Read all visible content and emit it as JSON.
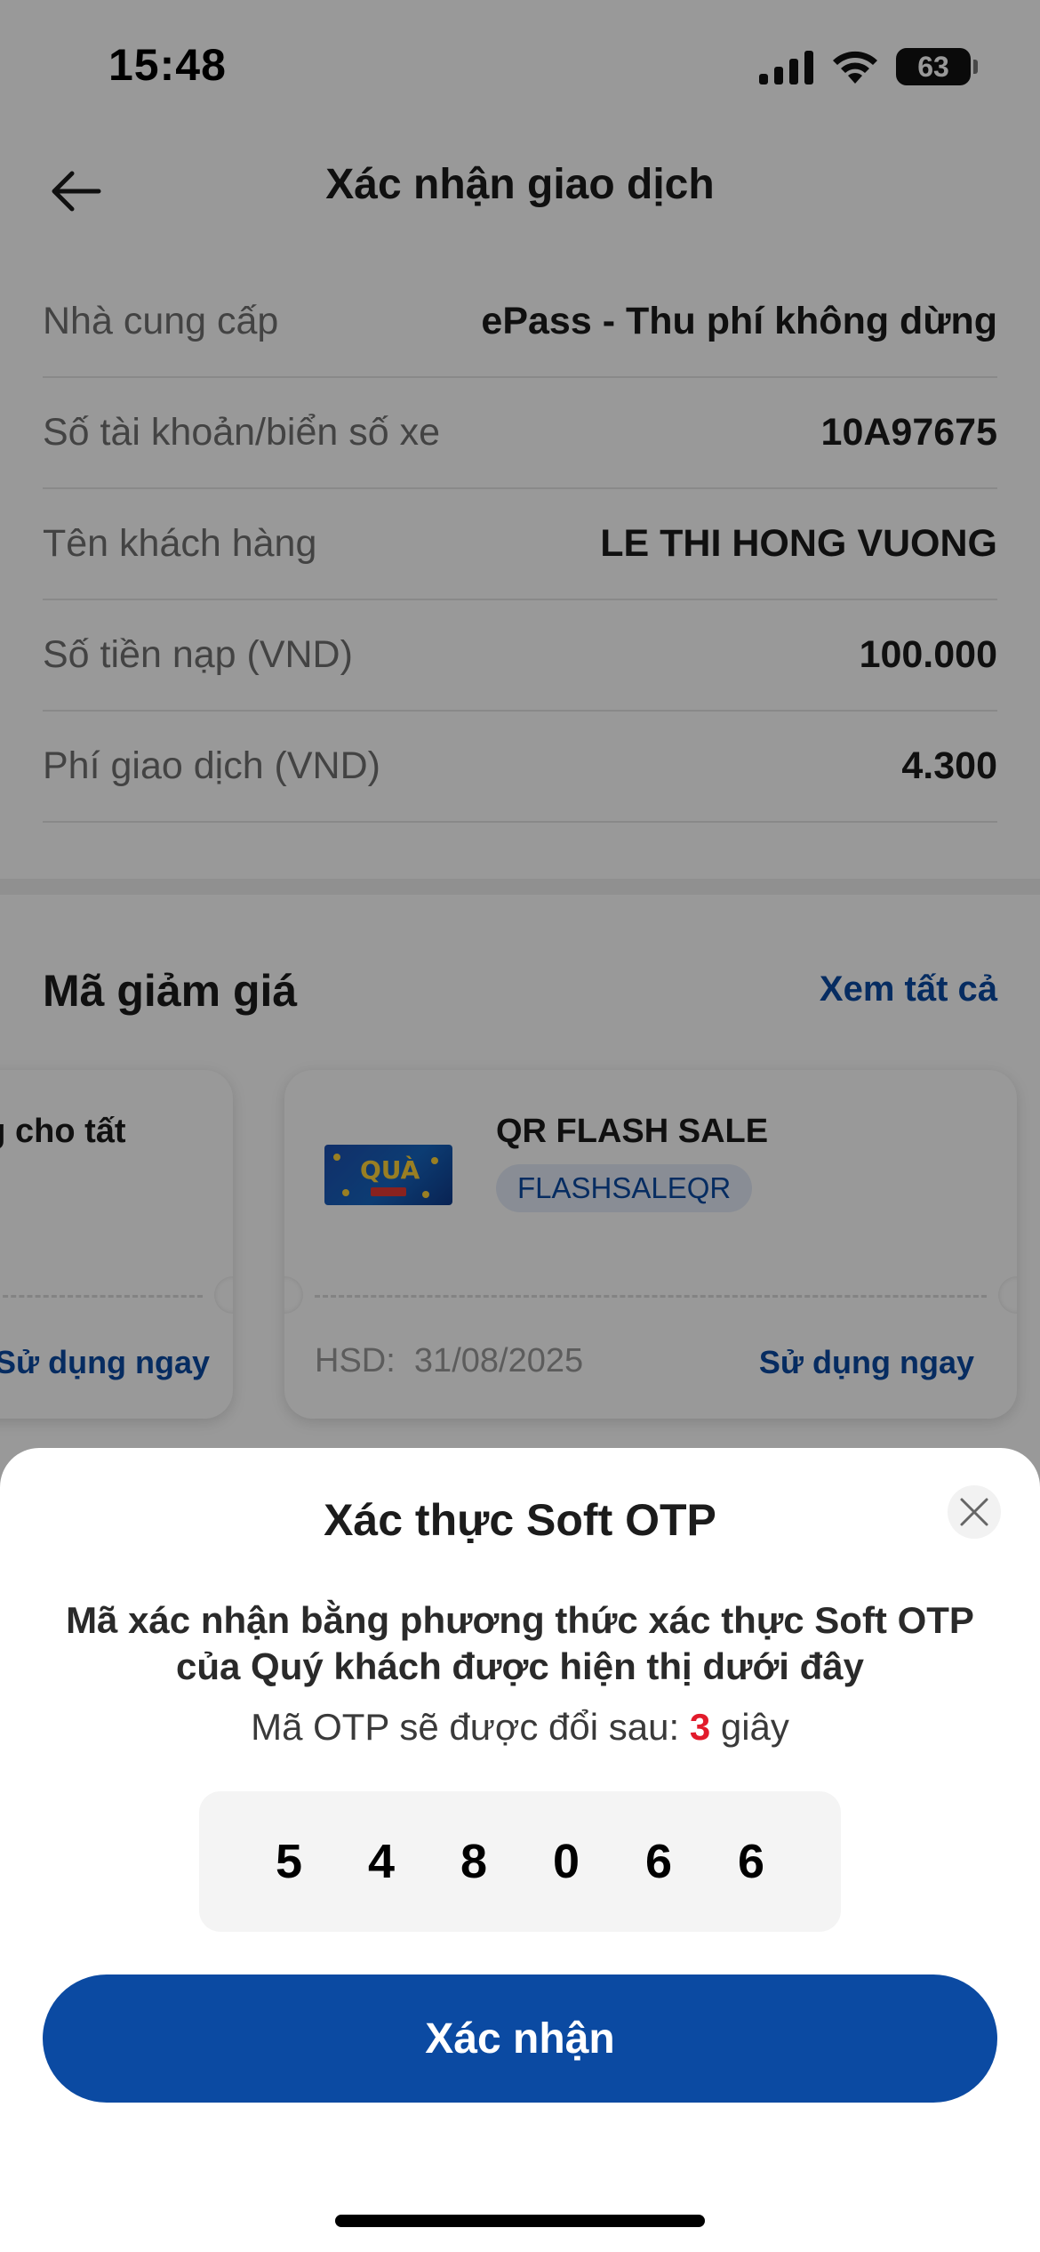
{
  "status_bar": {
    "time": "15:48",
    "battery": "63"
  },
  "header": {
    "title": "Xác nhận giao dịch"
  },
  "info_rows": [
    {
      "label": "Nhà cung cấp",
      "value": "ePass - Thu phí không dừng"
    },
    {
      "label": "Số tài khoản/biển số xe",
      "value": "10A97675"
    },
    {
      "label": "Tên khách hàng",
      "value": "LE THI HONG VUONG"
    },
    {
      "label": "Số tiền nạp (VND)",
      "value": "100.000"
    },
    {
      "label": "Phí giao dịch (VND)",
      "value": "4.300"
    }
  ],
  "discounts": {
    "title": "Mã giảm giá",
    "view_all": "Xem tất cả",
    "coupons": [
      {
        "title": "ng cho tất",
        "use_label": "Sử dụng ngay"
      },
      {
        "title": "QR FLASH SALE",
        "code": "FLASHSALEQR",
        "hsd_label": "HSD:",
        "hsd_date": "31/08/2025",
        "use_label": "Sử dụng ngay",
        "image_text": "QUÀ"
      }
    ]
  },
  "otp_sheet": {
    "title": "Xác thực Soft OTP",
    "description": "Mã xác nhận bằng phương thức xác thực Soft OTP của Quý khách được hiện thị dưới đây",
    "timer_prefix": "Mã OTP sẽ được đổi sau:",
    "timer_seconds": "3",
    "timer_suffix": "giây",
    "digits": [
      "5",
      "4",
      "8",
      "0",
      "6",
      "6"
    ],
    "confirm_label": "Xác nhận"
  },
  "colors": {
    "primary": "#0b4aa2",
    "accent_red": "#e21b2b"
  }
}
